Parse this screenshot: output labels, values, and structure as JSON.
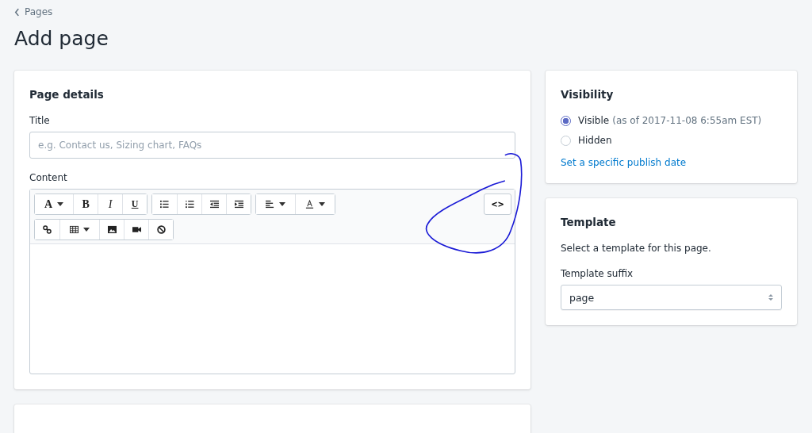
{
  "breadcrumb": {
    "label": "Pages"
  },
  "title": "Add page",
  "details": {
    "heading": "Page details",
    "title_label": "Title",
    "title_placeholder": "e.g. Contact us, Sizing chart, FAQs",
    "content_label": "Content",
    "toolbar_rows": [
      [
        [
          {
            "kind": "font",
            "label": "A",
            "dropdown": true
          },
          {
            "kind": "bold",
            "label": "B"
          },
          {
            "kind": "italic",
            "label": "I"
          },
          {
            "kind": "underline",
            "label": "U"
          }
        ],
        [
          {
            "kind": "bullets"
          },
          {
            "kind": "numbers"
          },
          {
            "kind": "outdent"
          },
          {
            "kind": "indent"
          }
        ],
        [
          {
            "kind": "align",
            "dropdown": true
          },
          {
            "kind": "color",
            "dropdown": true
          }
        ]
      ],
      [
        [
          {
            "kind": "link"
          },
          {
            "kind": "table",
            "dropdown": true
          },
          {
            "kind": "image"
          },
          {
            "kind": "video"
          },
          {
            "kind": "clear"
          }
        ]
      ]
    ],
    "code_button": "<>"
  },
  "visibility": {
    "heading": "Visibility",
    "options": [
      {
        "label": "Visible",
        "note": "(as of 2017-11-08 6:55am EST)",
        "selected": true
      },
      {
        "label": "Hidden",
        "selected": false
      }
    ],
    "link": "Set a specific publish date"
  },
  "template": {
    "heading": "Template",
    "description": "Select a template for this page.",
    "suffix_label": "Template suffix",
    "suffix_value": "page"
  }
}
